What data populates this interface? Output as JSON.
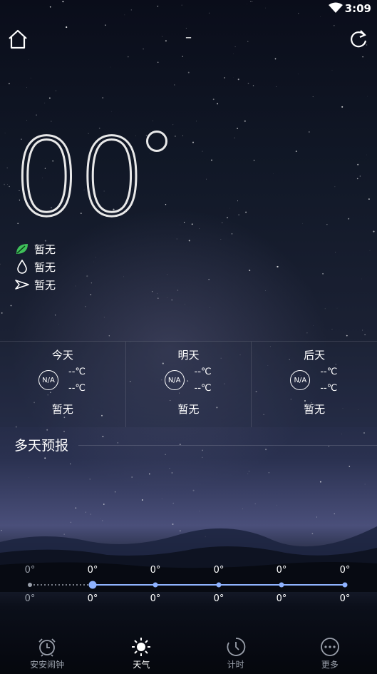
{
  "status_bar": {
    "time": "3:09"
  },
  "header": {
    "city": "–"
  },
  "current": {
    "temperature": "00",
    "details": [
      {
        "icon": "leaf-icon",
        "text": "暂无"
      },
      {
        "icon": "drop-icon",
        "text": "暂无"
      },
      {
        "icon": "wind-icon",
        "text": "暂无"
      }
    ]
  },
  "days": [
    {
      "name": "今天",
      "icon_text": "N/A",
      "hi": "--℃",
      "lo": "--℃",
      "cond": "暂无"
    },
    {
      "name": "明天",
      "icon_text": "N/A",
      "hi": "--℃",
      "lo": "--℃",
      "cond": "暂无"
    },
    {
      "name": "后天",
      "icon_text": "N/A",
      "hi": "--℃",
      "lo": "--℃",
      "cond": "暂无"
    }
  ],
  "multi_day": {
    "title": "多天预报",
    "high": [
      "0°",
      "0°",
      "0°",
      "0°",
      "0°",
      "0°"
    ],
    "low": [
      "0°",
      "0°",
      "0°",
      "0°",
      "0°",
      "0°"
    ]
  },
  "nav": [
    {
      "label": "安安闹钟",
      "icon": "alarm-clock-icon",
      "active": false
    },
    {
      "label": "天气",
      "icon": "sun-icon",
      "active": true
    },
    {
      "label": "计时",
      "icon": "timer-icon",
      "active": false
    },
    {
      "label": "更多",
      "icon": "more-icon",
      "active": false
    }
  ]
}
